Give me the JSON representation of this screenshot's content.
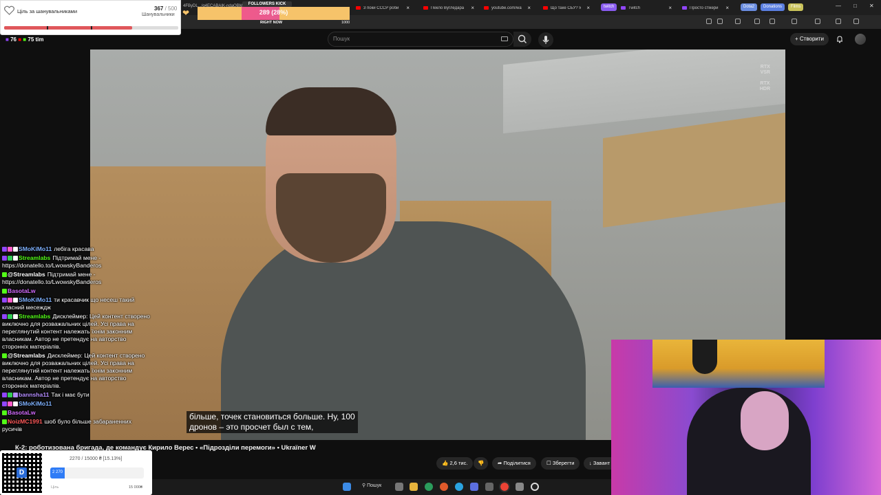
{
  "browser": {
    "tabs": [
      {
        "label": "3 поки СССР роби",
        "icon": "youtube-icon"
      },
      {
        "label": "Пекло Вугледара",
        "icon": "youtube-icon"
      },
      {
        "label": "youtube.com/watc",
        "icon": "youtube-icon"
      },
      {
        "label": "Що таке СБУ? Ісю",
        "icon": "youtube-icon"
      },
      {
        "label": "Twitch",
        "icon": "twitch-icon"
      },
      {
        "label": "Просто стікери",
        "icon": "twitch-icon"
      }
    ],
    "chips": [
      "twitch",
      "Dota2",
      "Donations",
      "Films"
    ],
    "address": "4FByDL.../g4ECABAIK-ndaQBMI_ZxY"
  },
  "youtube": {
    "search_placeholder": "Пошук",
    "create_label": "Створити",
    "video_title": "К-2: роботизована бригада, де командує Кирило Верес • «Підрозділи перемоги» • Ukraїner W",
    "subtitle": "більше, точек становиться больше. Ну, 100\nдронов – это просчет был с тем,",
    "rtx": [
      "RTX\nVSR",
      "RTX\nHDR"
    ],
    "actions": {
      "likes": "2,6 тис.",
      "share": "Поділитися",
      "save": "Зберегти",
      "download": "Завант"
    }
  },
  "goal": {
    "title": "Ціль за шанувальниками",
    "current": "367",
    "target": "500",
    "unit": "Шанувальники",
    "progress": 0.734
  },
  "followers_kick": {
    "label": "FOLLOWERS KICK",
    "text": "289 (28%)",
    "right_now": "RIGHT NOW",
    "max": "1000",
    "progress": 0.289
  },
  "overlay_counts": {
    "left": "76",
    "right": "75",
    "brand": "tim"
  },
  "chat": [
    {
      "badges": [
        "tw",
        "heart",
        "yt"
      ],
      "user": "SMoKiMo11",
      "color": "#7fb2ff",
      "text": "лебіга красава"
    },
    {
      "badges": [
        "tw",
        "check",
        "yt"
      ],
      "user": "Streamlabs",
      "color": "#53fc18",
      "text": "Підтримай мене - https://donatello.to/LwowskyBanderos"
    },
    {
      "badges": [
        "kick"
      ],
      "user": "@Streamlabs",
      "color": "#ffffff",
      "text": "Підтримай мене - https://donatello.to/LwowskyBanderos"
    },
    {
      "badges": [
        "kick"
      ],
      "user": "BasotaLw",
      "color": "#d36bff",
      "text": ""
    },
    {
      "badges": [
        "tw",
        "heart",
        "yt"
      ],
      "user": "SMoKiMo11",
      "color": "#7fb2ff",
      "text": "ти красавчик що несеш такий класний месеждж"
    },
    {
      "badges": [
        "tw",
        "check",
        "yt"
      ],
      "user": "Streamlabs",
      "color": "#53fc18",
      "text": "Дисклеймер: Цей контент створено виключно для розважальних цілей. Усі права на переглянутий контент належать їхнім законним власникам. Автор не претендує на авторство сторонніх матеріалів."
    },
    {
      "badges": [
        "kick"
      ],
      "user": "@Streamlabs",
      "color": "#ffffff",
      "text": "Дисклеймер: Цей контент створено виключно для розважальних цілей. Усі права на переглянутий контент належать їхнім законним власникам. Автор не претендує на авторство сторонніх матеріалів."
    },
    {
      "badges": [
        "tw",
        "check",
        "star"
      ],
      "user": "bannsha11",
      "color": "#b48cff",
      "text": "Так і має бути"
    },
    {
      "badges": [
        "tw",
        "heart",
        "yt"
      ],
      "user": "SMoKiMo11",
      "color": "#7fb2ff",
      "text": ""
    },
    {
      "badges": [
        "kick"
      ],
      "user": "BasotaLw",
      "color": "#d36bff",
      "text": ""
    },
    {
      "badges": [
        "kick"
      ],
      "user": "NoizMC1991",
      "color": "#ff5a5a",
      "text": "шоб було більше забараненних русичів"
    }
  ],
  "donation": {
    "text": "2270 / 15000 ₴ [15.13%]",
    "current": "2 270",
    "label": "Ціль",
    "max": "15 000₴",
    "progress": 0.1513,
    "qr_letter": "D"
  },
  "taskbar": {
    "search": "Пошук"
  }
}
